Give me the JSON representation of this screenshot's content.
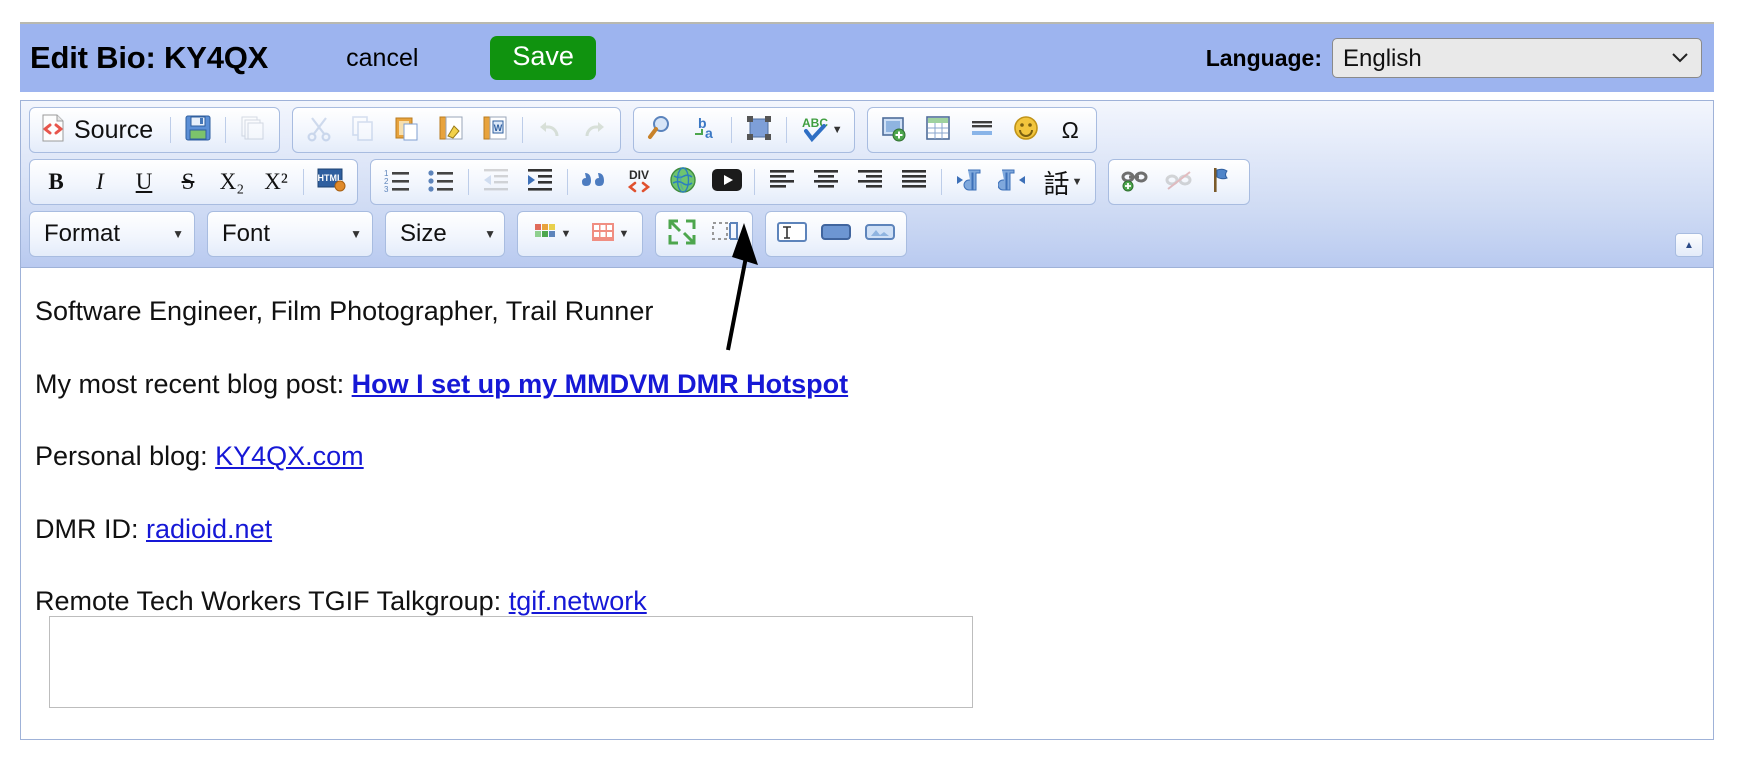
{
  "header": {
    "title": "Edit Bio: KY4QX",
    "cancel_label": "cancel",
    "save_label": "Save",
    "language_label": "Language:",
    "language_value": "English",
    "language_options": [
      "English"
    ],
    "bg_color": "#9db4ef",
    "save_color": "#10930f"
  },
  "toolbar": {
    "row1": [
      {
        "group": 1,
        "name": "source-button",
        "label": "Source",
        "icon": "source-icon",
        "disabled": false
      },
      {
        "group": 1,
        "name": "save-icon-button",
        "label": "",
        "icon": "floppy-save-icon",
        "disabled": false
      },
      {
        "group": 1,
        "name": "new-page-button",
        "label": "",
        "icon": "new-page-icon",
        "disabled": true
      },
      {
        "group": 2,
        "name": "cut-button",
        "label": "",
        "icon": "scissors-icon",
        "disabled": true
      },
      {
        "group": 2,
        "name": "copy-button",
        "label": "",
        "icon": "copy-icon",
        "disabled": true
      },
      {
        "group": 2,
        "name": "paste-button",
        "label": "",
        "icon": "paste-icon",
        "disabled": false
      },
      {
        "group": 2,
        "name": "paste-as-text-button",
        "label": "",
        "icon": "paste-text-icon",
        "disabled": false
      },
      {
        "group": 2,
        "name": "paste-from-word-button",
        "label": "",
        "icon": "paste-word-icon",
        "disabled": false
      },
      {
        "group": 2,
        "name": "undo-button",
        "label": "",
        "icon": "undo-icon",
        "disabled": true
      },
      {
        "group": 2,
        "name": "redo-button",
        "label": "",
        "icon": "redo-icon",
        "disabled": true
      },
      {
        "group": 3,
        "name": "find-button",
        "label": "",
        "icon": "magnifier-icon",
        "disabled": false
      },
      {
        "group": 3,
        "name": "replace-button",
        "label": "",
        "icon": "find-replace-icon",
        "disabled": false
      },
      {
        "group": 3,
        "name": "select-all-button",
        "label": "",
        "icon": "select-all-icon",
        "disabled": false
      },
      {
        "group": 3,
        "name": "spellcheck-button",
        "label": "",
        "icon": "abc-spellcheck-icon",
        "disabled": false
      },
      {
        "group": 4,
        "name": "image-button",
        "label": "",
        "icon": "image-icon",
        "disabled": false
      },
      {
        "group": 4,
        "name": "table-button",
        "label": "",
        "icon": "table-icon",
        "disabled": false
      },
      {
        "group": 4,
        "name": "horizontal-rule-button",
        "label": "",
        "icon": "horizontal-rule-icon",
        "disabled": false
      },
      {
        "group": 4,
        "name": "smiley-button",
        "label": "",
        "icon": "smiley-icon",
        "disabled": false
      },
      {
        "group": 4,
        "name": "special-char-button",
        "label": "Ω",
        "icon": "omega-icon",
        "disabled": false
      }
    ],
    "row2": [
      {
        "group": 1,
        "name": "bold-button",
        "label": "B",
        "icon": "bold-icon",
        "disabled": false
      },
      {
        "group": 1,
        "name": "italic-button",
        "label": "I",
        "icon": "italic-icon",
        "disabled": false
      },
      {
        "group": 1,
        "name": "underline-button",
        "label": "U",
        "icon": "underline-icon",
        "disabled": false
      },
      {
        "group": 1,
        "name": "strikethrough-button",
        "label": "S",
        "icon": "strikethrough-icon",
        "disabled": false
      },
      {
        "group": 1,
        "name": "subscript-button",
        "label": "X₂",
        "icon": "subscript-icon",
        "disabled": false
      },
      {
        "group": 1,
        "name": "superscript-button",
        "label": "X²",
        "icon": "superscript-icon",
        "disabled": false
      },
      {
        "group": 1,
        "name": "remove-format-button",
        "label": "",
        "icon": "html-badge-icon",
        "disabled": false
      },
      {
        "group": 2,
        "name": "numbered-list-button",
        "label": "",
        "icon": "numbered-list-icon",
        "disabled": false
      },
      {
        "group": 2,
        "name": "bulleted-list-button",
        "label": "",
        "icon": "bulleted-list-icon",
        "disabled": false
      },
      {
        "group": 2,
        "name": "outdent-button",
        "label": "",
        "icon": "outdent-icon",
        "disabled": true
      },
      {
        "group": 2,
        "name": "indent-button",
        "label": "",
        "icon": "indent-icon",
        "disabled": false
      },
      {
        "group": 2,
        "name": "blockquote-button",
        "label": "",
        "icon": "blockquote-icon",
        "disabled": false
      },
      {
        "group": 2,
        "name": "create-div-button",
        "label": "DIV",
        "icon": "div-container-icon",
        "disabled": false
      },
      {
        "group": 2,
        "name": "insert-iframe-button",
        "label": "",
        "icon": "globe-icon",
        "disabled": false
      },
      {
        "group": 2,
        "name": "insert-youtube-button",
        "label": "",
        "icon": "youtube-icon",
        "disabled": false
      },
      {
        "group": 2,
        "name": "align-left-button",
        "label": "",
        "icon": "align-left-icon",
        "disabled": false
      },
      {
        "group": 2,
        "name": "align-center-button",
        "label": "",
        "icon": "align-center-icon",
        "disabled": false
      },
      {
        "group": 2,
        "name": "align-right-button",
        "label": "",
        "icon": "align-right-icon",
        "disabled": false
      },
      {
        "group": 2,
        "name": "align-justify-button",
        "label": "",
        "icon": "align-justify-icon",
        "disabled": false
      },
      {
        "group": 2,
        "name": "text-direction-ltr-button",
        "label": "",
        "icon": "direction-ltr-icon",
        "disabled": false
      },
      {
        "group": 2,
        "name": "text-direction-rtl-button",
        "label": "",
        "icon": "direction-rtl-icon",
        "disabled": false
      },
      {
        "group": 2,
        "name": "language-button",
        "label": "話",
        "icon": "language-kanji-icon",
        "disabled": false
      },
      {
        "group": 3,
        "name": "link-button",
        "label": "",
        "icon": "link-icon",
        "disabled": false
      },
      {
        "group": 3,
        "name": "unlink-button",
        "label": "",
        "icon": "unlink-icon",
        "disabled": true
      },
      {
        "group": 3,
        "name": "anchor-button",
        "label": "",
        "icon": "anchor-flag-icon",
        "disabled": false
      }
    ],
    "row3": {
      "format_label": "Format",
      "font_label": "Font",
      "size_label": "Size",
      "buttons": [
        {
          "group": 4,
          "name": "text-color-button",
          "label": "",
          "icon": "text-color-icon",
          "disabled": false
        },
        {
          "group": 4,
          "name": "background-color-button",
          "label": "",
          "icon": "background-color-icon",
          "disabled": false
        },
        {
          "group": 5,
          "name": "maximize-button",
          "label": "",
          "icon": "maximize-icon",
          "disabled": false
        },
        {
          "group": 5,
          "name": "show-blocks-button",
          "label": "",
          "icon": "show-blocks-icon",
          "disabled": false
        },
        {
          "group": 6,
          "name": "textfield-button",
          "label": "",
          "icon": "text-field-icon",
          "disabled": false
        },
        {
          "group": 6,
          "name": "button-field-button",
          "label": "",
          "icon": "button-field-icon",
          "disabled": false
        },
        {
          "group": 6,
          "name": "image-button-field-button",
          "label": "",
          "icon": "image-button-icon",
          "disabled": false
        }
      ],
      "collapse_label": "▲"
    }
  },
  "document": {
    "paragraphs": [
      {
        "prefix": "Software Engineer, Film Photographer, Trail Runner",
        "link": "",
        "link_bold": false
      },
      {
        "prefix": "My most recent blog post: ",
        "link": "How I set up my MMDVM DMR Hotspot",
        "link_bold": true
      },
      {
        "prefix": "Personal blog: ",
        "link": "KY4QX.com",
        "link_bold": false
      },
      {
        "prefix": "DMR ID: ",
        "link": "radioid.net",
        "link_bold": false
      },
      {
        "prefix": "Remote Tech Workers TGIF Talkgroup: ",
        "link": "tgif.network",
        "link_bold": false
      }
    ],
    "link_color": "#1618d6"
  }
}
